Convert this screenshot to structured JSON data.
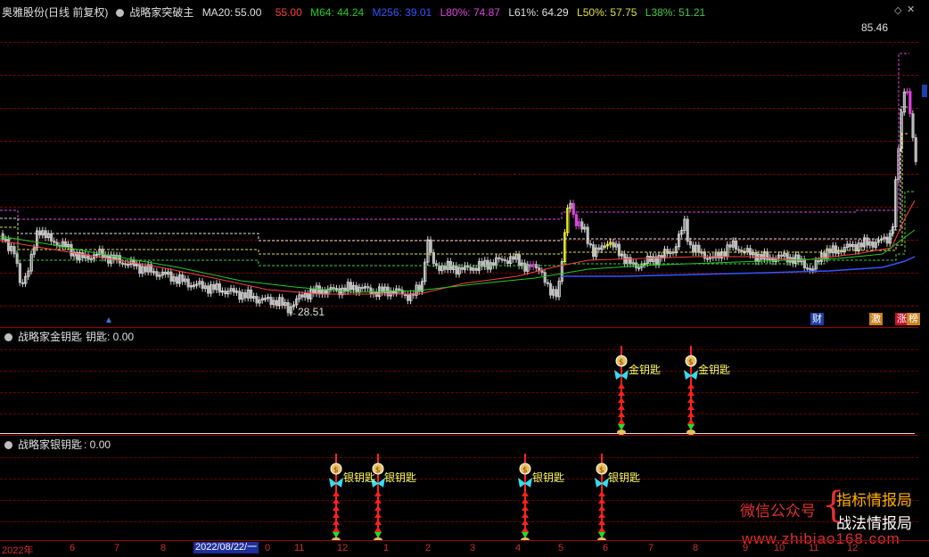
{
  "main_header": {
    "stock": "奥雅股份(日线 前复权)",
    "indicator": "战略家突破主",
    "ma20_label": "MA20:",
    "ma20_value": "55.00",
    "ma20_value2": "55.00",
    "m64": "M64: 44.24",
    "m256": "M256: 39.01",
    "l80": "L80%: 74.87",
    "l61": "L61%: 64.29",
    "l50": "L50%: 57.75",
    "l38": "L38%: 51.21"
  },
  "colors": {
    "m64": "#22cc22",
    "m256": "#3355ff",
    "l80": "#dd44dd",
    "l61": "#e0e0e0",
    "l50": "#e0e040",
    "l38": "#44cc44",
    "ma20": "#ff4040",
    "grid": "#7a0000",
    "panel_line": "#a00000"
  },
  "price_labels": {
    "high": "85.46",
    "low": "28.51"
  },
  "badges": {
    "cai": "财",
    "ji": "激",
    "zhang": "涨",
    "bang": "榜"
  },
  "gold_panel": {
    "title": "战略家金钥匙",
    "value": "钥匙: 0.00",
    "tag1": "金钥匙",
    "tag2": "金钥匙"
  },
  "silver_panel": {
    "title": "战略家银钥匙",
    "value": ": 0.00",
    "tag1": "银钥匙",
    "tag2": "银钥匙",
    "tag3": "银钥匙",
    "tag4": "银钥匙"
  },
  "x_axis": {
    "year": "2022年",
    "m6": "6",
    "m7": "7",
    "m8": "8",
    "date_box": "2022/08/22/一",
    "m10": "0",
    "m11": "11",
    "m12": "12",
    "m1": "1",
    "m2": "2",
    "m3": "3",
    "m4": "4",
    "m5": "5",
    "m6b": "6",
    "m7b": "7",
    "m8b": "8",
    "m9": "9",
    "m10b": "10",
    "m11b": "11",
    "m12b": "12"
  },
  "watermark": {
    "wechat": "微信公众号",
    "line1": "指标情报局",
    "line2": "战法情报局",
    "url": "www.zhibiao168.com"
  }
}
